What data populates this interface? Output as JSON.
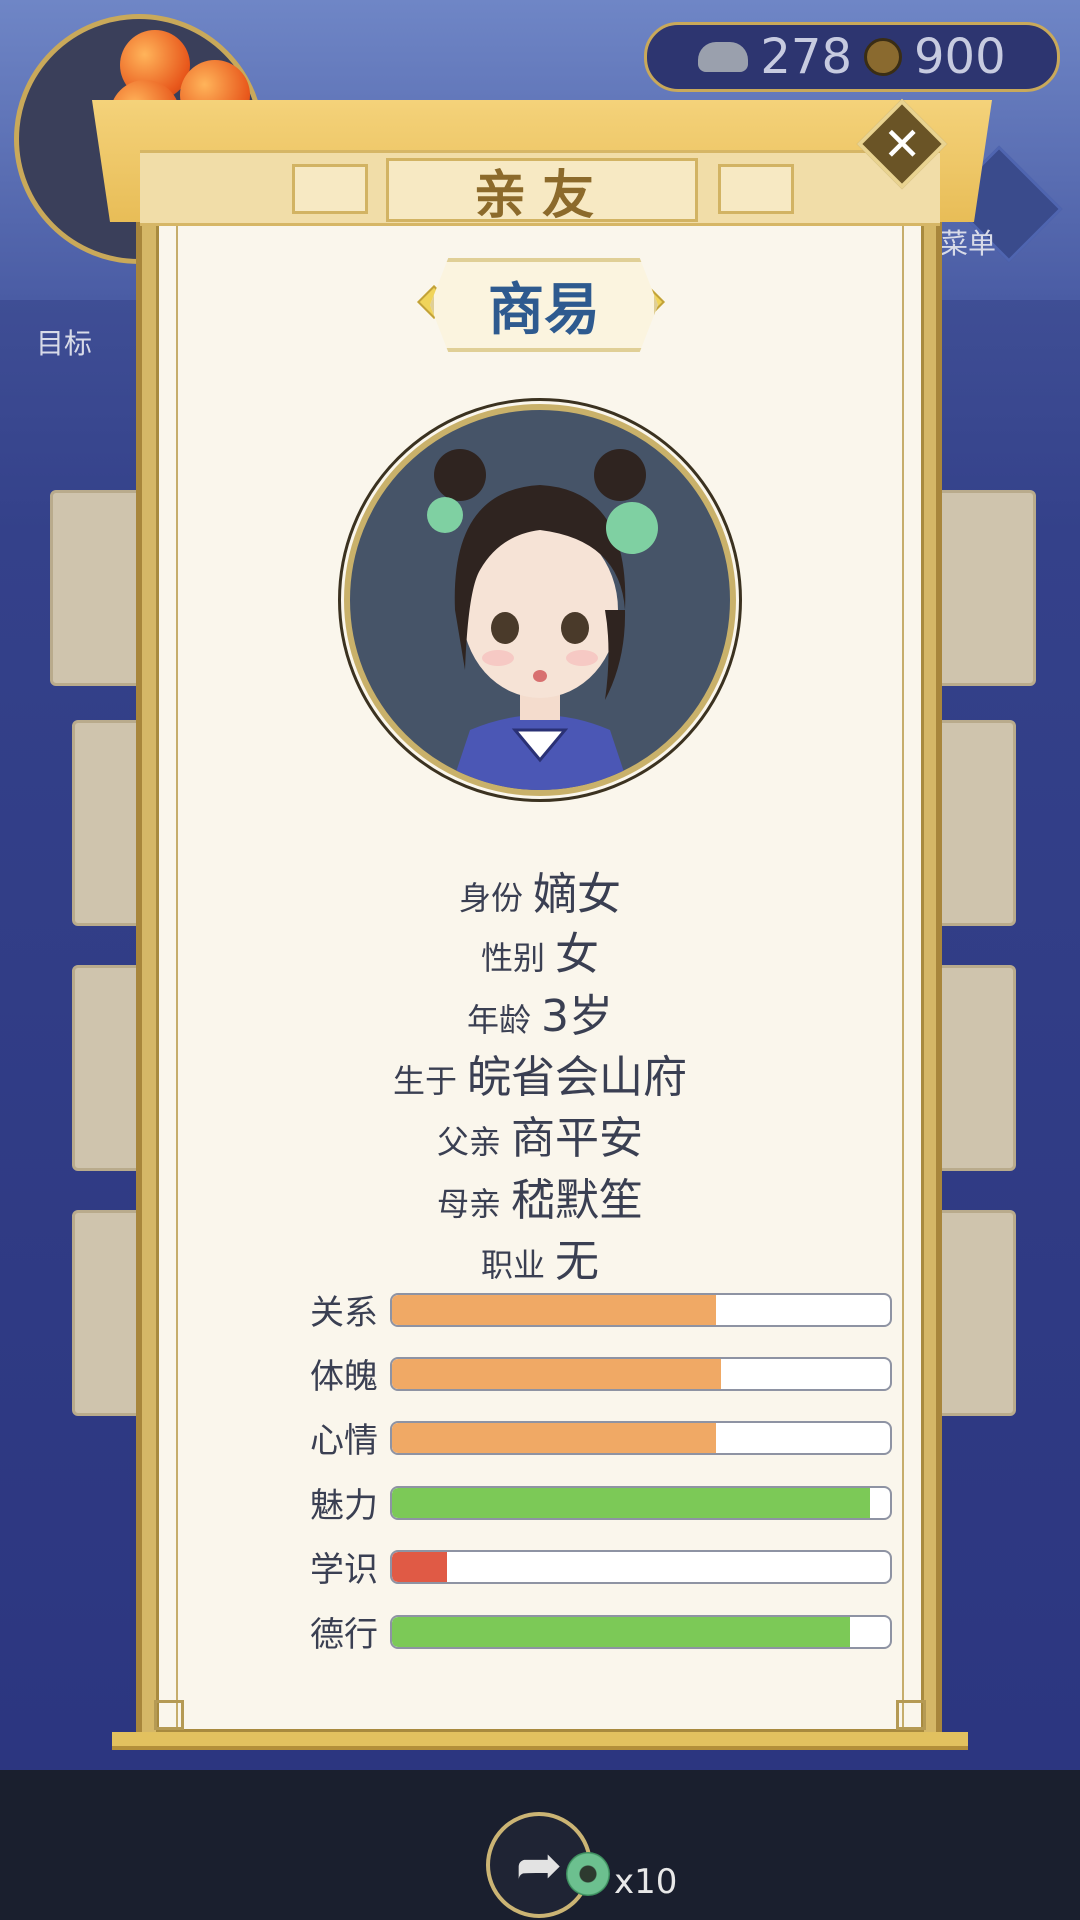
{
  "hud": {
    "silver": "278",
    "copper": "900",
    "side_left_label": "目标",
    "side_right_label": "菜单"
  },
  "dialog": {
    "title": "亲友",
    "name": "商易",
    "info": [
      {
        "key": "身份",
        "value": "嫡女"
      },
      {
        "key": "性别",
        "value": "女"
      },
      {
        "key": "年龄",
        "value": "3岁"
      },
      {
        "key": "生于",
        "value": "皖省会山府"
      },
      {
        "key": "父亲",
        "value": "商平安"
      },
      {
        "key": "母亲",
        "value": "嵇默笙"
      },
      {
        "key": "职业",
        "value": "无"
      }
    ],
    "stats": [
      {
        "label": "关系",
        "value": 0.65,
        "color": "#f0a965"
      },
      {
        "label": "体魄",
        "value": 0.66,
        "color": "#f0a965"
      },
      {
        "label": "心情",
        "value": 0.65,
        "color": "#f0a965"
      },
      {
        "label": "魅力",
        "value": 0.96,
        "color": "#7cc957"
      },
      {
        "label": "学识",
        "value": 0.11,
        "color": "#e05a45"
      },
      {
        "label": "德行",
        "value": 0.92,
        "color": "#7cc957"
      }
    ]
  },
  "footer": {
    "share_count": "x10"
  },
  "icons": {
    "close": "close-icon",
    "share": "share-icon",
    "jade": "jade-token-icon",
    "silver": "silver-ingot-icon",
    "copper": "copper-coin-icon"
  }
}
